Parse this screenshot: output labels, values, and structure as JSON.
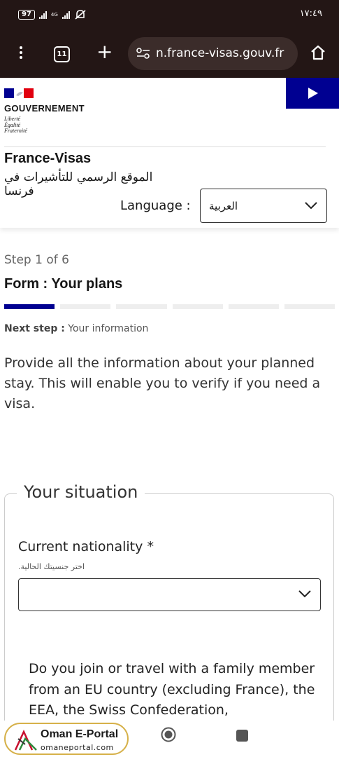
{
  "status_bar": {
    "battery": "97",
    "network": "4G",
    "time": "١٧:٤٩"
  },
  "browser": {
    "tab_count": "11",
    "url": "n.france-visas.gouv.fr"
  },
  "gov_header": {
    "title": "GOUVERNEMENT",
    "motto": [
      "Liberté",
      "Égalité",
      "Fraternité"
    ],
    "site_name": "France-Visas",
    "site_subtitle": "الموقع الرسمي للتأشيرات في فرنسا",
    "language_label": "Language :",
    "language_value": "العربية"
  },
  "form": {
    "step_count": "Step 1 of 6",
    "title": "Form : Your plans",
    "steps_total": 6,
    "current_step": 1,
    "next_step_label": "Next step :",
    "next_step_value": "Your information",
    "intro": "Provide all the information about your planned stay. This will enable you to verify if you need a visa."
  },
  "situation": {
    "legend": "Your situation",
    "nationality_label": "Current nationality",
    "required_mark": "*",
    "nationality_hint": "اختر جنسيتك الحالية.",
    "nationality_value": "",
    "question": "Do you join or travel with a family member from an EU country (excluding France), the EEA, the Swiss Confederation,"
  },
  "watermark": {
    "title": "Oman E-Portal",
    "url": "omaneportal.com"
  },
  "colors": {
    "primary_blue": "#000091",
    "marianne_red": "#e1000f",
    "status_bar_bg": "#231615"
  }
}
